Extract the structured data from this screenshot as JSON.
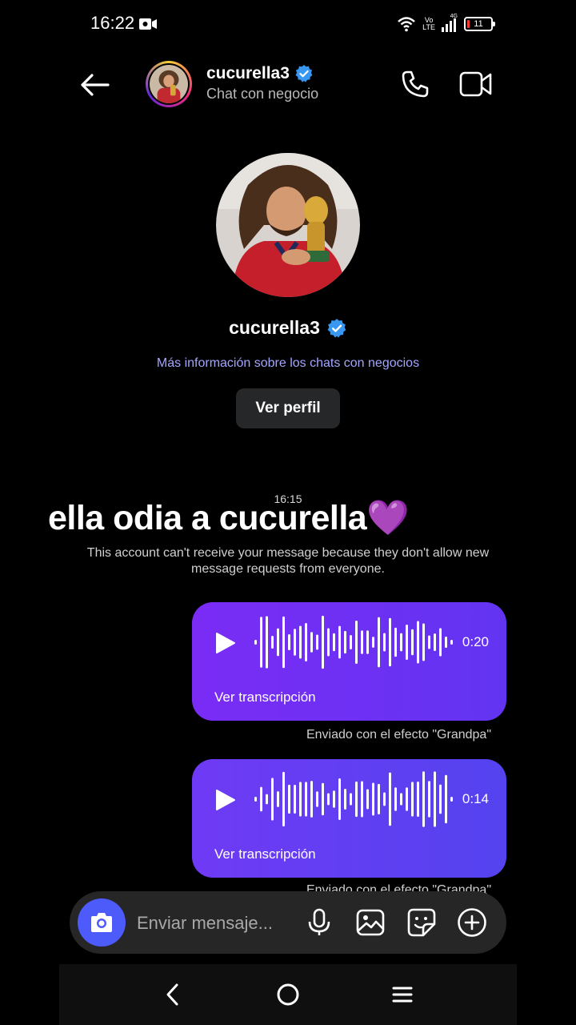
{
  "status_bar": {
    "time": "16:22",
    "network_top": "Vo",
    "network_bottom": "LTE",
    "signal_label": "4G",
    "battery": "11",
    "battery_level": 0.11
  },
  "header": {
    "username": "cucurella3",
    "subtitle": "Chat con negocio"
  },
  "profile": {
    "username": "cucurella3",
    "info_link": "Más información sobre los chats con negocios",
    "view_profile_button": "Ver perfil"
  },
  "chat": {
    "timestamp": "16:15",
    "overlay_caption": "ella odia a cucurella💜",
    "notice": "This account can't receive your message because they don't allow new message requests from everyone.",
    "messages": [
      {
        "type": "voice",
        "duration": "0:20",
        "transcript_label": "Ver transcripción",
        "effect_note": "Enviado con el efecto \"Grandpa\""
      },
      {
        "type": "voice",
        "duration": "0:14",
        "transcript_label": "Ver transcripción",
        "effect_note": "Enviado con el efecto \"Grandpa\""
      }
    ]
  },
  "composer": {
    "placeholder": "Enviar mensaje..."
  },
  "icons": {
    "back": "arrow-left-icon",
    "call": "phone-icon",
    "video": "video-camera-icon",
    "verified": "verified-badge-icon",
    "camera": "camera-icon",
    "mic": "microphone-icon",
    "gallery": "image-icon",
    "sticker": "sticker-icon",
    "more": "plus-circle-icon"
  },
  "colors": {
    "accent": "#4d5bfa",
    "bubble1": "#7a2cf5",
    "bubble2": "#5443ef",
    "verified": "#3897f0",
    "link": "#a3a6ff"
  }
}
